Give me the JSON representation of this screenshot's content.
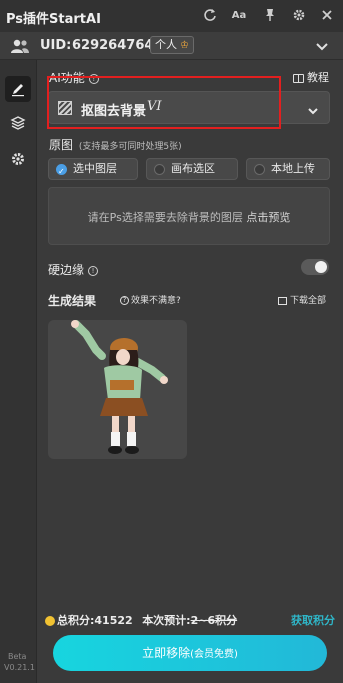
{
  "titlebar": {
    "title": "Ps插件StartAI",
    "icons": [
      "refresh-icon",
      "font-size-icon",
      "pin-icon",
      "settings-icon",
      "close-icon"
    ],
    "font_size_label": "Aa"
  },
  "user": {
    "uid_label": "UID:",
    "uid_value": "629264764",
    "role": "个人"
  },
  "sidebar": {
    "items": [
      "brush-icon",
      "layers-icon",
      "gear-icon"
    ],
    "version_line1": "Beta",
    "version_line2": "V0.21.1"
  },
  "ai_function": {
    "label": "AI功能",
    "tutorial_label": "教程",
    "selected_feature": "抠图去背景",
    "badge": "VI"
  },
  "source": {
    "label": "原图",
    "hint": "(支持最多可同时处理5张)",
    "options": [
      "选中图层",
      "画布选区",
      "本地上传"
    ],
    "selected_index": 0,
    "drop_text": "请在Ps选择需要去除背景的图层",
    "drop_link": "点击预览"
  },
  "hard_edge": {
    "label": "硬边缘",
    "enabled": false
  },
  "results": {
    "label": "生成结果",
    "feedback": "效果不满意?",
    "download_all": "下载全部"
  },
  "footer": {
    "total_points_label": "总积分:",
    "total_points": "41522",
    "estimate_label": "本次预计:",
    "estimate_value": "2~6积分",
    "get_points": "获取积分",
    "action_label": "立即移除",
    "action_sub": "(会员免费)"
  },
  "colors": {
    "accent": "#1fc8dc",
    "highlight_box": "#e21f1f",
    "coin": "#f1c232",
    "radio_selected": "#4b9fe6"
  }
}
